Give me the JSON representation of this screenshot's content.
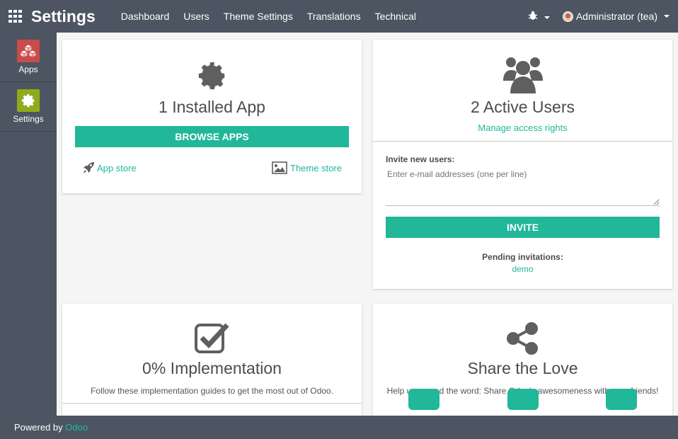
{
  "header": {
    "title": "Settings",
    "menu": [
      "Dashboard",
      "Users",
      "Theme Settings",
      "Translations",
      "Technical"
    ],
    "user": "Administrator (tea)"
  },
  "sidebar": {
    "items": [
      {
        "label": "Apps",
        "icon": "apps-cubes-icon",
        "color": "#c94b4b"
      },
      {
        "label": "Settings",
        "icon": "gear-icon",
        "color": "#8fab1c"
      }
    ]
  },
  "cards": {
    "apps": {
      "title": "1 Installed App",
      "button": "BROWSE APPS",
      "app_store": "App store",
      "theme_store": "Theme store"
    },
    "users": {
      "title": "2 Active Users",
      "manage": "Manage access rights",
      "invite_label": "Invite new users:",
      "invite_placeholder": "Enter e-mail addresses (one per line)",
      "invite_button": "INVITE",
      "pending_label": "Pending invitations:",
      "pending_user": "demo"
    },
    "implementation": {
      "title": "0% Implementation",
      "subtitle": "Follow these implementation guides to get the most out of Odoo."
    },
    "share": {
      "title": "Share the Love",
      "subtitle": "Help us spread the word: Share Odoo's awesomeness with your friends!"
    }
  },
  "footer": {
    "powered_by": "Powered by",
    "brand": "Odoo"
  },
  "colors": {
    "accent": "#21b799",
    "navbar": "#4c5561"
  }
}
